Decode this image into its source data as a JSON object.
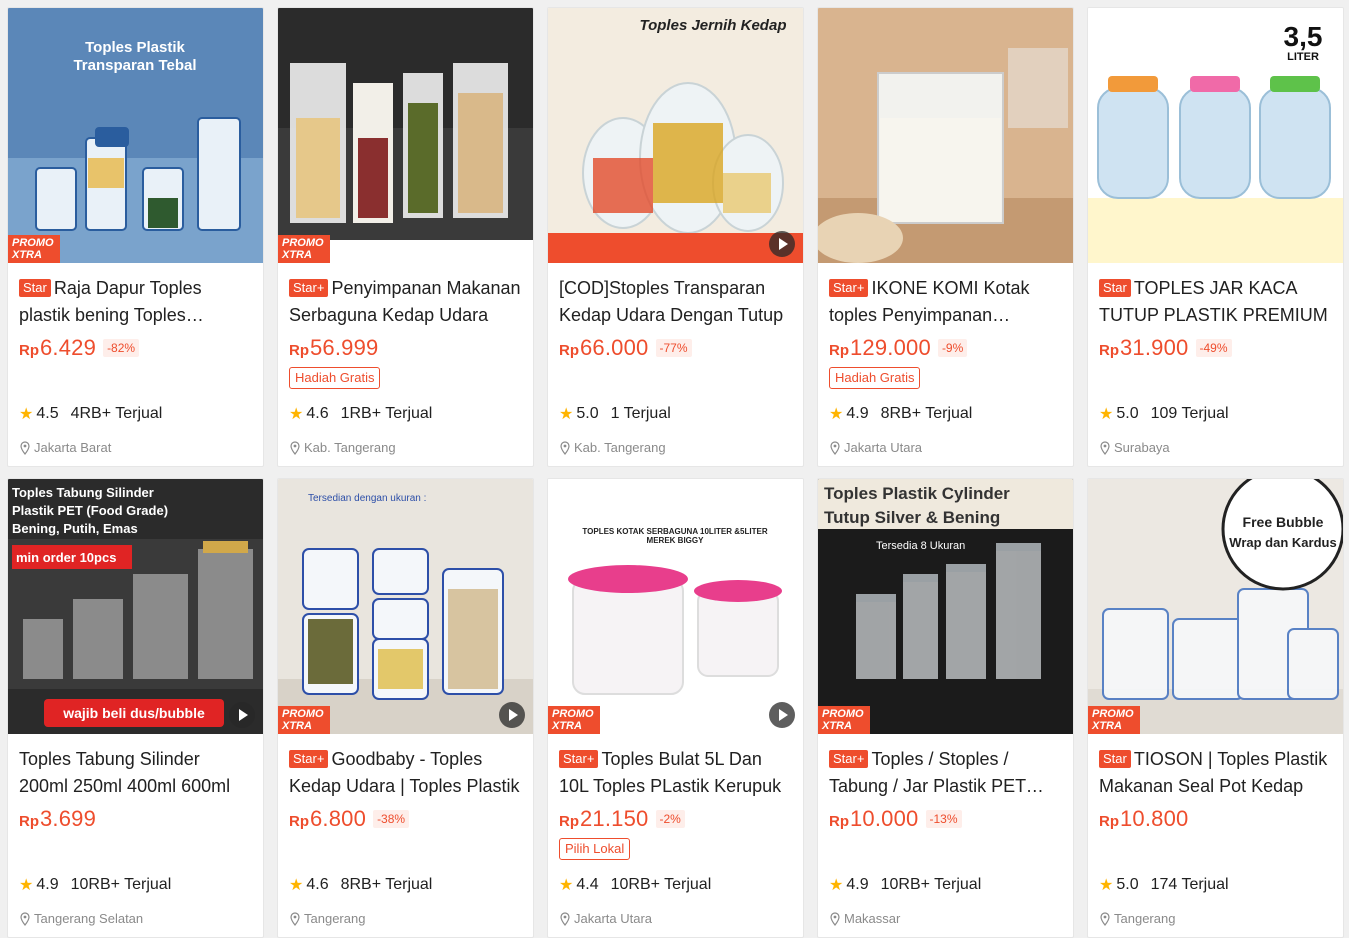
{
  "colors": {
    "accent": "#ee4d2d",
    "star": "#ffb400"
  },
  "products": [
    {
      "title": "Raja Dapur Toples plastik bening Toples Transparan Tebal",
      "badge": "Star",
      "currency": "Rp",
      "price": "6.429",
      "discount": "-82%",
      "tag": "",
      "rating": "4.5",
      "sold": "4RB+ Terjual",
      "location": "Jakarta Barat",
      "promo_line1": "PROMO",
      "promo_line2": "XTRA",
      "thumb_text": [
        "Toples Plastik",
        "Transparan Tebal"
      ],
      "video": false
    },
    {
      "title": "Penyimpanan Makanan Serbaguna Kedap Udara",
      "badge": "Star+",
      "currency": "Rp",
      "price": "56.999",
      "discount": "",
      "tag": "Hadiah Gratis",
      "rating": "4.6",
      "sold": "1RB+ Terjual",
      "location": "Kab. Tangerang",
      "promo_line1": "PROMO",
      "promo_line2": "XTRA",
      "thumb_text": [],
      "video": false
    },
    {
      "title": "[COD]Stoples Transparan Kedap Udara Dengan Tutup",
      "badge": "",
      "currency": "Rp",
      "price": "66.000",
      "discount": "-77%",
      "tag": "",
      "rating": "5.0",
      "sold": "1 Terjual",
      "location": "Kab. Tangerang",
      "promo_line1": "",
      "promo_line2": "",
      "thumb_text": [
        "Toples Jernih Kedap"
      ],
      "video": true
    },
    {
      "title": "IKONE KOMI Kotak toples Penyimpanan Makanan",
      "badge": "Star+",
      "currency": "Rp",
      "price": "129.000",
      "discount": "-9%",
      "tag": "Hadiah Gratis",
      "rating": "4.9",
      "sold": "8RB+ Terjual",
      "location": "Jakarta Utara",
      "promo_line1": "",
      "promo_line2": "",
      "thumb_text": [],
      "video": false
    },
    {
      "title": "TOPLES JAR KACA TUTUP PLASTIK PREMIUM",
      "badge": "Star",
      "currency": "Rp",
      "price": "31.900",
      "discount": "-49%",
      "tag": "",
      "rating": "5.0",
      "sold": "109 Terjual",
      "location": "Surabaya",
      "promo_line1": "",
      "promo_line2": "",
      "thumb_text": [
        "3,5",
        "LITER"
      ],
      "video": false
    },
    {
      "title": "Toples Tabung Silinder 200ml 250ml 400ml 600ml",
      "badge": "",
      "currency": "Rp",
      "price": "3.699",
      "discount": "",
      "tag": "",
      "rating": "4.9",
      "sold": "10RB+ Terjual",
      "location": "Tangerang Selatan",
      "promo_line1": "",
      "promo_line2": "",
      "thumb_text": [
        "Toples Tabung Silinder",
        "Plastik PET (Food Grade)",
        "Bening, Putih, Emas",
        "min order 10pcs",
        "wajib beli dus/bubble"
      ],
      "video": true
    },
    {
      "title": "Goodbaby - Toples Kedap Udara | Toples Plastik",
      "badge": "Star+",
      "currency": "Rp",
      "price": "6.800",
      "discount": "-38%",
      "tag": "",
      "rating": "4.6",
      "sold": "8RB+ Terjual",
      "location": "Tangerang",
      "promo_line1": "PROMO",
      "promo_line2": "XTRA",
      "thumb_text": [
        "Tersedian dengan ukuran :"
      ],
      "video": true
    },
    {
      "title": "Toples Bulat 5L Dan 10L Toples PLastik Kerupuk",
      "badge": "Star+",
      "currency": "Rp",
      "price": "21.150",
      "discount": "-2%",
      "tag": "Pilih Lokal",
      "rating": "4.4",
      "sold": "10RB+ Terjual",
      "location": "Jakarta Utara",
      "promo_line1": "PROMO",
      "promo_line2": "XTRA",
      "thumb_text": [
        "TOPLES KOTAK SERBAGUNA 10LITER &5LITER",
        "MEREK BIGGY"
      ],
      "video": true
    },
    {
      "title": "Toples / Stoples / Tabung / Jar Plastik PET Silinder",
      "badge": "Star+",
      "currency": "Rp",
      "price": "10.000",
      "discount": "-13%",
      "tag": "",
      "rating": "4.9",
      "sold": "10RB+ Terjual",
      "location": "Makassar",
      "promo_line1": "PROMO",
      "promo_line2": "XTRA",
      "thumb_text": [
        "Toples Plastik Cylinder",
        "Tutup Silver & Bening",
        "Tersedia 8 Ukuran"
      ],
      "video": false
    },
    {
      "title": "TIOSON | Toples Plastik Makanan Seal Pot Kedap",
      "badge": "Star",
      "currency": "Rp",
      "price": "10.800",
      "discount": "",
      "tag": "",
      "rating": "5.0",
      "sold": "174 Terjual",
      "location": "Tangerang",
      "promo_line1": "PROMO",
      "promo_line2": "XTRA",
      "thumb_text": [
        "Free Bubble",
        "Wrap dan Kardus"
      ],
      "video": false
    }
  ]
}
